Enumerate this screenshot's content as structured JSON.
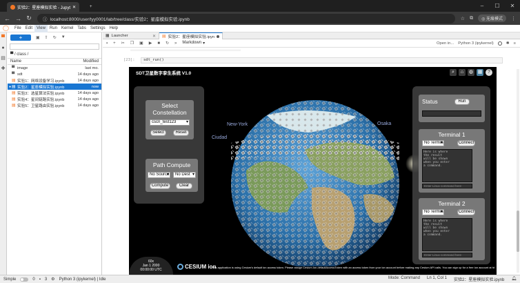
{
  "browser": {
    "tabs": [
      {
        "title": "实验2：星座模拟实验 - Jupyt",
        "active": true
      },
      {
        "title": "",
        "active": false
      }
    ],
    "url": "localhost:8000/user/tyy0001/lab/tree/class/实验2：星座模拟实验.ipynb",
    "profile_label": "无痕模式"
  },
  "menu": [
    "File",
    "Edit",
    "View",
    "Run",
    "Kernel",
    "Tabs",
    "Settings",
    "Help"
  ],
  "menu_active": "View",
  "file_browser": {
    "new_label": "+",
    "filter_placeholder": "Filter files by name",
    "breadcrumb": "/ class /",
    "col_name": "Name",
    "col_modified": "Modified",
    "rows": [
      {
        "name": "image",
        "modified": "last mo.",
        "type": "folder",
        "running": false,
        "selected": false
      },
      {
        "name": "sdt",
        "modified": "14 days ago",
        "type": "folder",
        "running": false,
        "selected": false
      },
      {
        "name": "实验1：网络设备学习.ipynb",
        "modified": "14 days ago",
        "type": "notebook",
        "running": false,
        "selected": false
      },
      {
        "name": "实验2：星座模拟实验.ipynb",
        "modified": "now",
        "type": "notebook",
        "running": true,
        "selected": true
      },
      {
        "name": "实验3：选星算法实验.ipynb",
        "modified": "14 days ago",
        "type": "notebook",
        "running": false,
        "selected": false
      },
      {
        "name": "实验4：星间链路实验.ipynb",
        "modified": "14 days ago",
        "type": "notebook",
        "running": false,
        "selected": false
      },
      {
        "name": "实验5：卫星路由实验.ipynb",
        "modified": "14 days ago",
        "type": "notebook",
        "running": false,
        "selected": false
      }
    ]
  },
  "doc_tabs": [
    {
      "label": "Launcher",
      "active": false
    },
    {
      "label": "实验2：星座模拟实验.ipynb",
      "active": true
    }
  ],
  "notebook_toolbar": {
    "cell_type": "Markdown",
    "open_in": "Open in...",
    "kernel": "Python 3 (ipykernel)"
  },
  "cell": {
    "prompt": "[23]:",
    "code": "sdt_run()"
  },
  "sdt": {
    "title": "SDT卫星数字孪生系统 V1.0",
    "select_constellation": {
      "title_line1": "Select",
      "title_line2": "Constellation",
      "value": "cscn_test123",
      "select_btn": "Select",
      "reset_btn": "Reset"
    },
    "path_compute": {
      "title": "Path Compute",
      "source": "No Source",
      "dest": "No Dest",
      "compute_btn": "Compute",
      "clear_btn": "Clear"
    },
    "status": {
      "label": "Status",
      "run_btn": "Run"
    },
    "terminals": [
      {
        "title": "Terminal 1",
        "select": "No Terminal",
        "connect_btn": "Connect",
        "output": "Here is where\nthe result\nwill be shown\nwhen you enter\na command.\n\n\n\n\n$",
        "placeholder": "Enter Linux command here"
      },
      {
        "title": "Terminal 2",
        "select": "No Terminal",
        "connect_btn": "Connect",
        "output": "Here is where\nthe result\nwill be shown\nwhen you enter\na command.\n\n\n\n\n$",
        "placeholder": "Enter Linux command here"
      }
    ],
    "city_labels": [
      "New-York",
      "Ciudad",
      "Osaka"
    ],
    "clock": {
      "speed": "60x",
      "date": "Jan 1 2000",
      "time": "00:00:00 UTC"
    },
    "cesium_label": "CESIUM ion",
    "cesium_note": "This application is using Cesium's default ion access token. Please assign Cesium.Ion.defaultAccessToken with an access token from your ion account before making any Cesium API calls. You can sign up for a free ion account at https://cesium.com."
  },
  "status_bar": {
    "mode_label": "Simple",
    "counts": [
      "0",
      "3"
    ],
    "kernel_status": "Python 3 (ipykernel) | Idle",
    "mode": "Mode: Command",
    "cursor": "Ln 1, Col 1",
    "file": "实验2：星座模拟实验.ipynb"
  },
  "colors": {
    "accent": "#1976d2",
    "jupyter_orange": "#f37726",
    "panel_bg": "#404040",
    "ocean": "#2a6fa8"
  }
}
